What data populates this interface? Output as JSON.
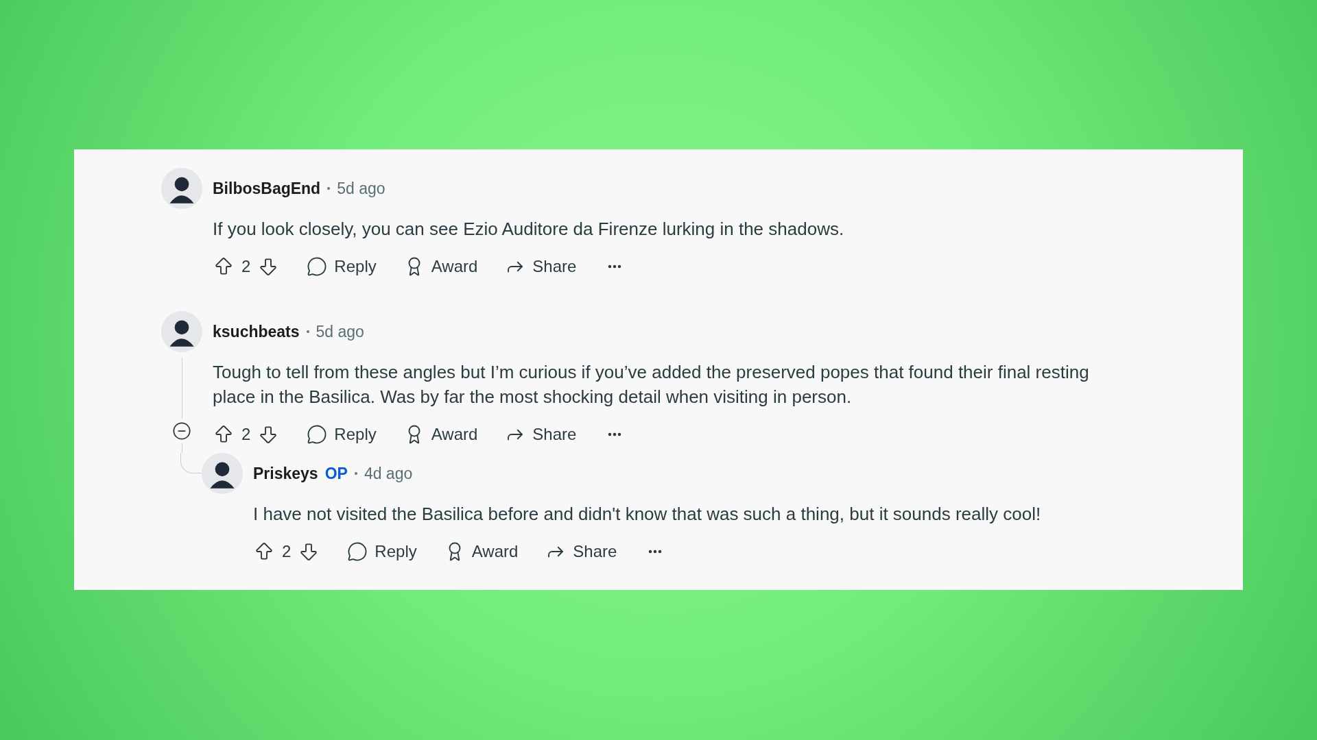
{
  "comments": [
    {
      "author": "BilbosBagEnd",
      "time": "5d ago",
      "body": "If you look closely, you can see Ezio Auditore da Firenze lurking in the shadows.",
      "score": "2",
      "actions": [
        "Reply",
        "Award",
        "Share"
      ]
    },
    {
      "author": "ksuchbeats",
      "time": "5d ago",
      "body": "Tough to tell from these angles but I’m curious if you’ve added the preserved popes that found their final resting place in the Basilica. Was by far the most shocking detail when visiting in person.",
      "score": "2",
      "actions": [
        "Reply",
        "Award",
        "Share"
      ],
      "expanded": true,
      "children": [
        {
          "author": "Priskeys",
          "flair": "OP",
          "time": "4d ago",
          "body": "I have not visited the Basilica before and didn't know that was such a thing, but it sounds really cool!",
          "score": "2",
          "actions": [
            "Reply",
            "Award",
            "Share"
          ]
        }
      ]
    }
  ]
}
